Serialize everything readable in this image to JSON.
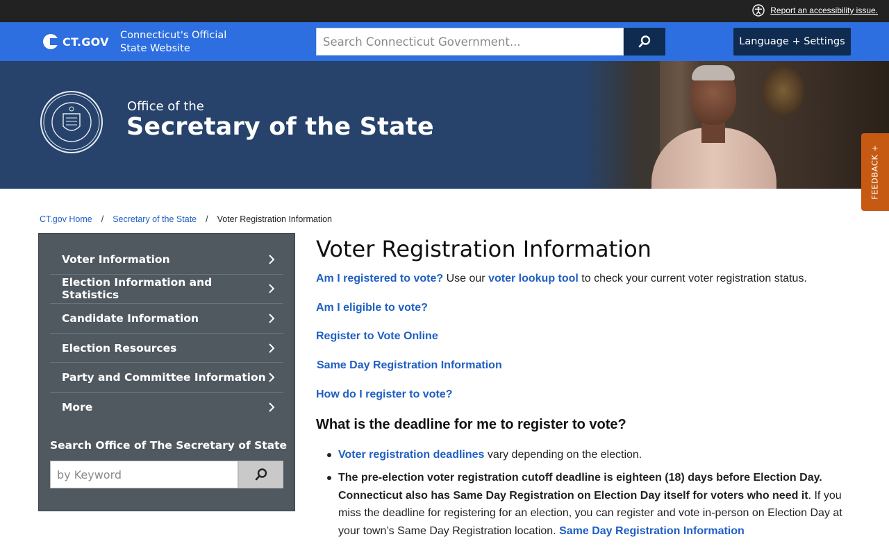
{
  "utility_bar": {
    "accessibility_link": "Report an accessibility issue."
  },
  "ct_header": {
    "logo_text": "CT.GOV",
    "tagline_line1": "Connecticut's Official",
    "tagline_line2": "State Website",
    "search_placeholder": "Search Connecticut Government...",
    "language_button": "Language + Settings",
    "brand_color": "#2d6ee0"
  },
  "hero": {
    "office_of": "Office of the",
    "title": "Secretary of the State"
  },
  "feedback_tab": "FEEDBACK +",
  "breadcrumb": {
    "home": "CT.gov Home",
    "section": "Secretary of the State",
    "current": "Voter Registration Information"
  },
  "sidebar": {
    "items": [
      {
        "label": "Voter Information"
      },
      {
        "label": "Election Information and Statistics"
      },
      {
        "label": "Candidate Information"
      },
      {
        "label": "Election Resources"
      },
      {
        "label": "Party and Committee Information"
      },
      {
        "label": "More"
      }
    ],
    "search_title": "Search Office of The Secretary of State",
    "search_placeholder": "by Keyword"
  },
  "main": {
    "title": "Voter Registration Information",
    "line1_link1": "Am I registered to vote?",
    "line1_text1": " Use our ",
    "line1_link2": "voter lookup tool",
    "line1_text2": " to check your current voter registration status.",
    "link_eligible": "Am I eligible to vote?",
    "link_register_online": "Register to Vote Online",
    "link_same_day": "Same Day Registration Information",
    "link_how_register": "How do I register to vote?",
    "deadline_heading": "What is the deadline for me to register to vote?",
    "bullet1_link": "Voter registration deadlines",
    "bullet1_text": " vary depending on the election.",
    "bullet2_bold": "The pre-election voter registration cutoff deadline is eighteen (18) days before Election Day. Connecticut also has Same Day Registration on Election Day itself for voters who need it",
    "bullet2_text": ". If you miss the deadline for registering for an election, you can register and vote in-person on Election Day at your town’s Same Day Registration location. ",
    "bullet2_link": "Same Day Registration Information"
  },
  "colors": {
    "link": "#1f5fc4",
    "hero_bg": "#27436b",
    "dark_button": "#0f2b50",
    "sidebar_bg": "#505860",
    "feedback": "#c65a12"
  }
}
